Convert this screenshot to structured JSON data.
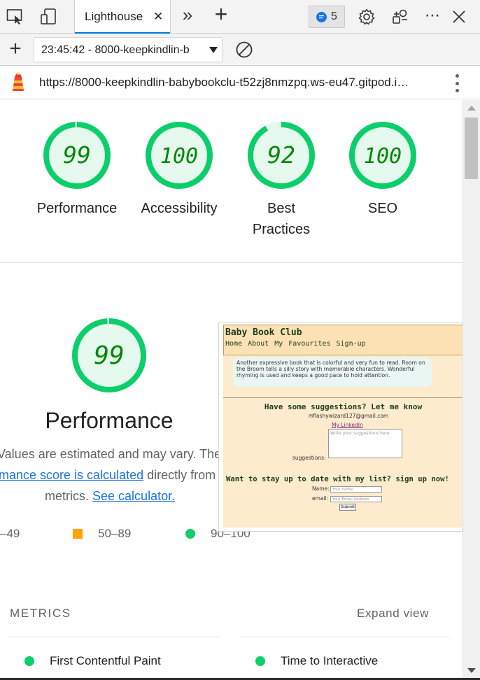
{
  "devtools": {
    "tabs": [
      "Lighthouse"
    ],
    "tab_close": "✕",
    "more_tabs": "»",
    "new_tab": "+",
    "issues_count": "5",
    "more_menu": "⋯",
    "close": "✕"
  },
  "lighthouse_toolbar": {
    "new_report": "+",
    "report_select_value": "23:45:42 - 8000-keepkindlin-b"
  },
  "url_bar": {
    "url": "https://8000-keepkindlin-babybookclu-t52zj8nmzpq.ws-eu47.gitpod.i…"
  },
  "scores": [
    {
      "value": 99,
      "label": "Performance",
      "fraction": 0.99
    },
    {
      "value": 100,
      "label": "Accessibility",
      "fraction": 1.0
    },
    {
      "value": 92,
      "label": "Best Practices",
      "fraction": 0.92
    },
    {
      "value": 100,
      "label": "SEO",
      "fraction": 1.0
    }
  ],
  "performance": {
    "score": 99,
    "fraction": 0.99,
    "title": "Performance",
    "desc_line1": "Values are estimated and may vary. The",
    "desc_link1": "mance score is calculated",
    "desc_line2_rest": " directly from t",
    "desc_line3": "metrics.",
    "desc_link2": "See calculator."
  },
  "legend": [
    {
      "range": "–49",
      "shape": "triangle",
      "color": "#ff4e42"
    },
    {
      "range": "50–89",
      "shape": "square",
      "color": "#ffa400"
    },
    {
      "range": "90–100",
      "shape": "circle",
      "color": "#0cce6b"
    }
  ],
  "metrics_section": {
    "heading": "METRICS",
    "expand": "Expand view",
    "items": [
      "First Contentful Paint",
      "Time to Interactive"
    ]
  },
  "thumbnail": {
    "brand": "Baby Book Club",
    "nav": "Home  About  My Favourites  Sign-up",
    "card_text": "Another expressive book that is colorful and very fun to read. Room on the Broom tells a silly story with memorable characters. Wonderful rhyming is used and keeps a good pace to hold attention.",
    "suggest_heading": "Have some suggestions? Let me know",
    "email": "✉flashywizard127@gmail.com",
    "linkedin": "My LinkedIn",
    "textarea_placeholder": "Write your suggestions here",
    "suggestions_label": "suggestions:",
    "signup_heading": "Want to stay up to date with my list? sign up now!",
    "name_label": "Name:",
    "name_placeholder": "Your name",
    "email_label": "email:",
    "email_placeholder": "Your Email Address",
    "submit": "Submit"
  },
  "colors": {
    "pass": "#0cce6b",
    "pass_text": "#008800",
    "pass_fill": "#e6f9ee",
    "average": "#ffa400",
    "link": "#1a73e8"
  }
}
